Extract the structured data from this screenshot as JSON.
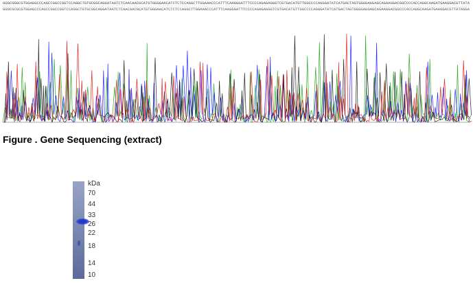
{
  "figure": {
    "caption": "Figure . Gene Sequencing (extract)"
  },
  "chromatogram": {
    "trace_colors": {
      "A": "#00a000",
      "C": "#0000ff",
      "G": "#000000",
      "T": "#e00000"
    },
    "sequence_top": "GGGCGGGCGTGGAGGCCCAGCCGGCCGGTCCAGGCTGTGCGGCAGGATAATCTCAACAACGCATGTGGGGAACATCTCTCCAGGCTTGGAAACCCATTTCAAGGGATTTCCCCAGAGAGGGTCGTGACATGTTGGCCCCAGGGATATCATGACTAGTGGGGAGGAGCAGAAGGACGGCCCCACCAGGCAAGATGAAGGACGTTATA",
    "sequence_bottom": "GGGCGCGCGTGGAGCCCAGCCGGCCGGTCCAGGCTGTGCGGCAGGATAATCTCAACAACGCATGTGGGAACATCTCTCCAGGCTTGGAAACCCATTTCAAGGGATTTCCCCAGAGAGGGTCGTGACATGTTGGCCCCAGGGATATCATGACTAGTGGGGAGGAGCAGAAGGACGGCCCACCAGGCAAGATGAAGGACGTTATAGGA"
  },
  "gel": {
    "unit_label": "kDa",
    "markers": [
      "70",
      "44",
      "33",
      "26",
      "22",
      "18",
      "14",
      "10"
    ],
    "band_color": "#2236c8"
  }
}
